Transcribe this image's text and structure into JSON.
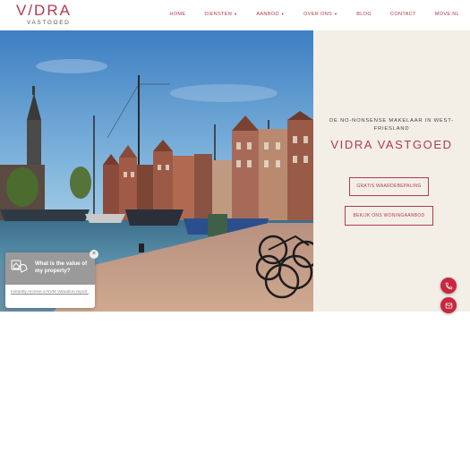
{
  "header": {
    "logo": {
      "main": "V/DRA",
      "sub": "VASTGOED"
    },
    "nav": [
      {
        "label": "HOME",
        "dropdown": false
      },
      {
        "label": "DIENSTEN",
        "dropdown": true
      },
      {
        "label": "AANBOD",
        "dropdown": true
      },
      {
        "label": "OVER ONS",
        "dropdown": true
      },
      {
        "label": "BLOG",
        "dropdown": false
      },
      {
        "label": "CONTACT",
        "dropdown": false
      },
      {
        "label": "MOVE.NL",
        "dropdown": false
      }
    ]
  },
  "hero": {
    "tagline": "DE NO-NONSENSE MAKELAAR IN WEST-FRIESLAND",
    "brand": "VIDRA VASTGOED",
    "button_valuation": "GRATIS WAARDEBEPALING",
    "button_listings": "BEKIJK ONS WONINGAANBOD"
  },
  "popup": {
    "title": "What is the value of my property?",
    "link": "Instantly receive a NVM Valuation report.",
    "close": "×"
  },
  "icons": {
    "caret": "caret-down-icon",
    "phone": "phone-icon",
    "mail": "mail-icon",
    "house": "house-valuation-icon",
    "close": "close-icon"
  },
  "colors": {
    "accent": "#b23a4e",
    "fab": "#c8273f",
    "panel_bg": "#f3efe7",
    "popup_header": "#9a9a9a"
  }
}
